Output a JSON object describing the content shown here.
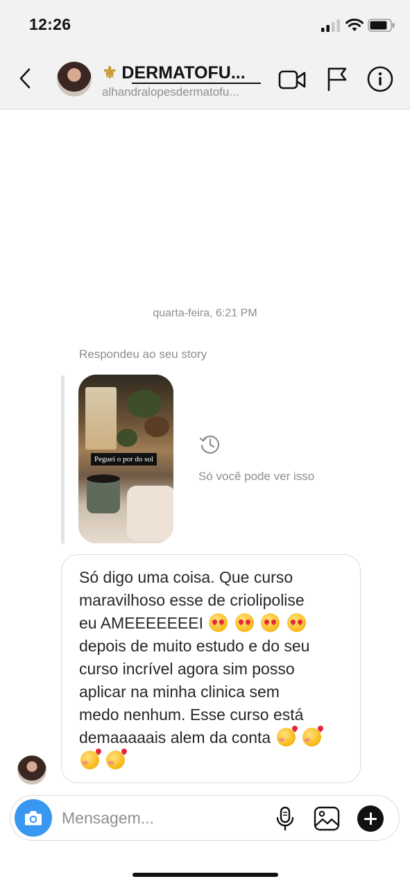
{
  "status": {
    "time": "12:26"
  },
  "header": {
    "name": "DERMATOFU...",
    "username": "alhandralopesdermatofu..."
  },
  "chat": {
    "date_label": "quarta-feira, 6:21 PM",
    "story_reply_label": "Respondeu ao seu story",
    "story_caption": "Peguei o por do sol",
    "only_you_label": "Só você pode ver isso",
    "message": {
      "line1": "Só digo uma coisa. Que curso",
      "line2": "maravilhoso esse de criolipolise",
      "line3": "eu AMEEEEEEEI",
      "line4": "depois de muito estudo e do seu",
      "line5": "curso incrível agora sim posso",
      "line6": "aplicar na minha clinica sem",
      "line7": "medo nenhum. Esse curso está",
      "line8": "demaaaaais alem da conta"
    }
  },
  "composer": {
    "placeholder": "Mensagem..."
  },
  "colors": {
    "accent": "#3897f0",
    "meta_text": "#8e8e8e",
    "fleur": "#c99a2e"
  },
  "icons": [
    "back-chevron-icon",
    "video-call-icon",
    "flag-icon",
    "info-icon",
    "history-icon",
    "camera-icon",
    "microphone-icon",
    "gallery-icon",
    "plus-icon"
  ]
}
